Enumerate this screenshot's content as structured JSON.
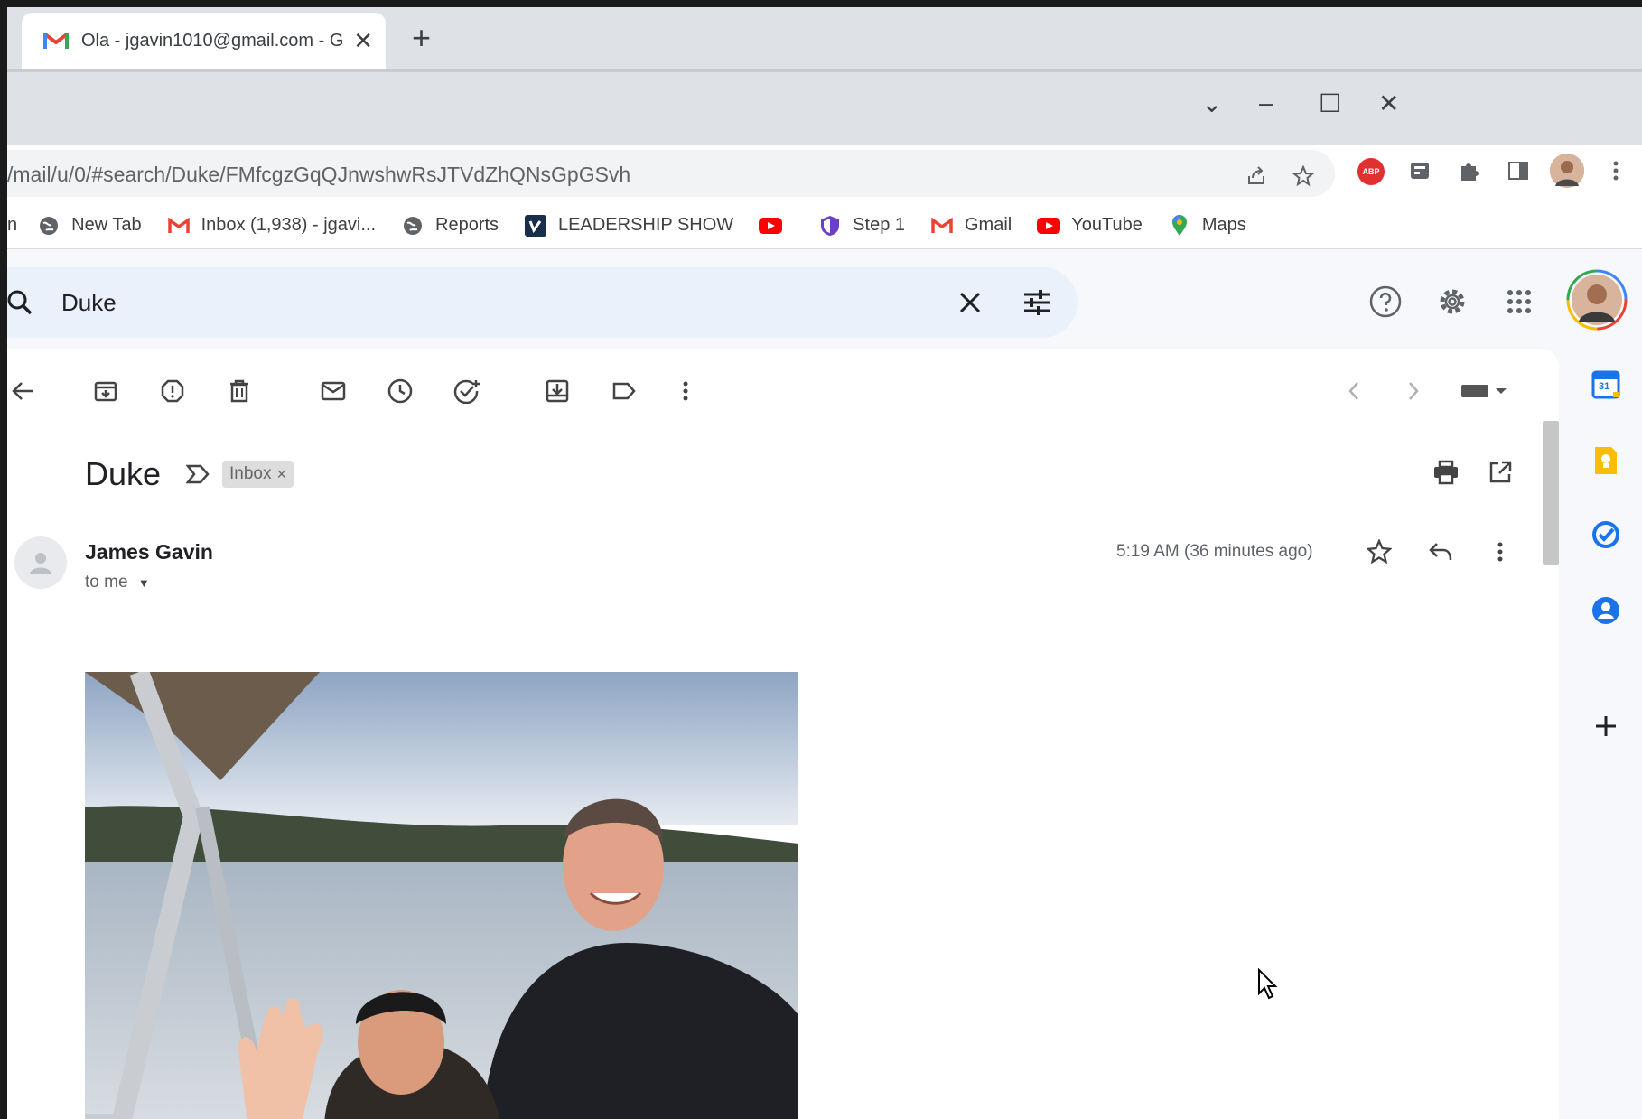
{
  "browser": {
    "tab_title": "Ola - jgavin1010@gmail.com - G",
    "url": "/mail/u/0/#search/Duke/FMfcgzGqQJnwshwRsJTVdZhQNsGpGSvh",
    "bookmarks": [
      {
        "label": "New Tab",
        "icon": "globe-icon"
      },
      {
        "label": "Inbox (1,938) - jgavi...",
        "icon": "gmail-icon"
      },
      {
        "label": "Reports",
        "icon": "globe-icon"
      },
      {
        "label": "LEADERSHIP SHOW",
        "icon": "vimeo-icon"
      },
      {
        "label": "",
        "icon": "youtube-icon"
      },
      {
        "label": "Step 1",
        "icon": "shield-icon"
      },
      {
        "label": "Gmail",
        "icon": "gmail-icon"
      },
      {
        "label": "YouTube",
        "icon": "youtube-icon"
      },
      {
        "label": "Maps",
        "icon": "maps-icon"
      }
    ],
    "truncated_bookmark": "n",
    "extension_badge": "ABP"
  },
  "gmail": {
    "search_query": "Duke",
    "subject": "Duke",
    "label_chip": "Inbox",
    "label_chip_close": "×",
    "sender": "James Gavin",
    "recipient": "to me",
    "timestamp": "5:19 AM (36 minutes ago)",
    "calendar_day": "31"
  },
  "colors": {
    "gmail_red": "#ea4335",
    "google_blue": "#1a73e8",
    "keep_yellow": "#fbbc04",
    "youtube_red": "#ff0000"
  }
}
